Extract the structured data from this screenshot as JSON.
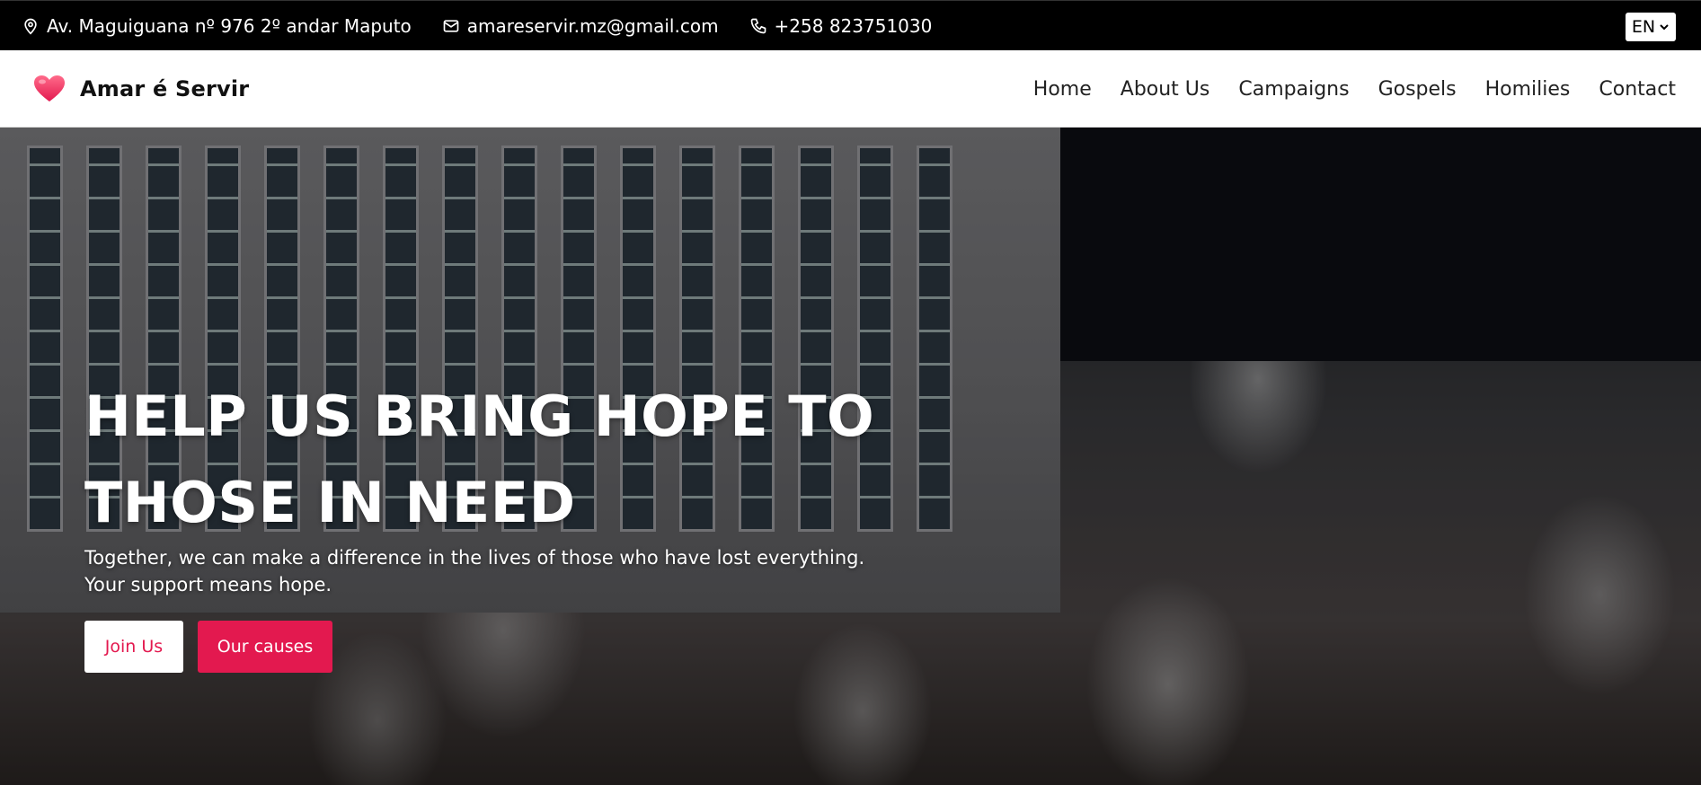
{
  "topbar": {
    "address": "Av. Maguiguana nº 976 2º andar Maputo",
    "email": "amareservir.mz@gmail.com",
    "phone": "+258 823751030",
    "language": "EN",
    "icons": [
      "map-pin-icon",
      "mail-icon",
      "phone-icon",
      "chevron-down-icon"
    ]
  },
  "navbar": {
    "brand": "Amar é Servir",
    "logo_icon": "heart-icon",
    "links": [
      "Home",
      "About Us",
      "Campaigns",
      "Gospels",
      "Homilies",
      "Contact"
    ]
  },
  "hero": {
    "title": "HELP US BRING HOPE TO THOSE IN NEED",
    "subtitle": "Together, we can make a difference in the lives of those who have lost everything. Your support means hope.",
    "primary_button": "Join Us",
    "secondary_button": "Our causes"
  },
  "colors": {
    "accent": "#e3194f",
    "topbar_bg": "#000000",
    "navbar_bg": "#ffffff"
  }
}
